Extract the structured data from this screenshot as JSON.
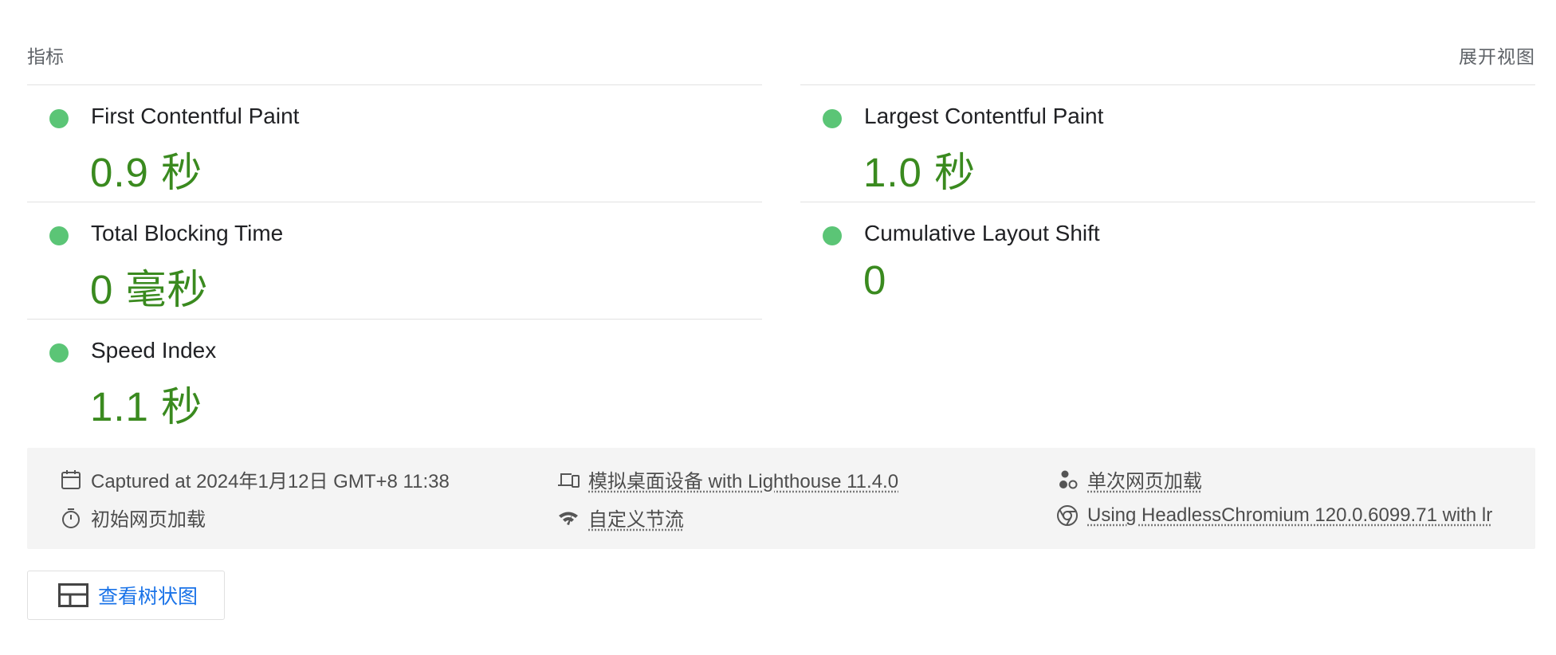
{
  "metrics_section": {
    "title": "指标",
    "expand_label": "展开视图",
    "items": [
      {
        "label": "First Contentful Paint",
        "value": "0.9 秒",
        "status": "pass"
      },
      {
        "label": "Largest Contentful Paint",
        "value": "1.0 秒",
        "status": "pass"
      },
      {
        "label": "Total Blocking Time",
        "value": "0 毫秒",
        "status": "pass"
      },
      {
        "label": "Cumulative Layout Shift",
        "value": "0",
        "status": "pass"
      },
      {
        "label": "Speed Index",
        "value": "1.1 秒",
        "status": "pass"
      }
    ]
  },
  "runtime_info": {
    "captured_at": "Captured at 2024年1月12日 GMT+8 11:38",
    "device": "模拟桌面设备 with Lighthouse 11.4.0",
    "page_load_mode": "单次网页加载",
    "initial_load": "初始网页加载",
    "throttling": "自定义节流",
    "browser": "Using HeadlessChromium 120.0.6099.71 with lr",
    "icons": {
      "captured_at": "calendar-icon",
      "device": "devices-icon",
      "page_load_mode": "single-load-icon",
      "initial_load": "stopwatch-icon",
      "throttling": "network-icon",
      "browser": "chrome-icon"
    }
  },
  "treemap_button": {
    "label": "查看树状图",
    "icon": "treemap-icon"
  },
  "colors": {
    "pass_dot": "#5bc576",
    "pass_value": "#3a8a1f",
    "link": "#1a73e8",
    "runtime_bg": "#f4f4f4"
  }
}
